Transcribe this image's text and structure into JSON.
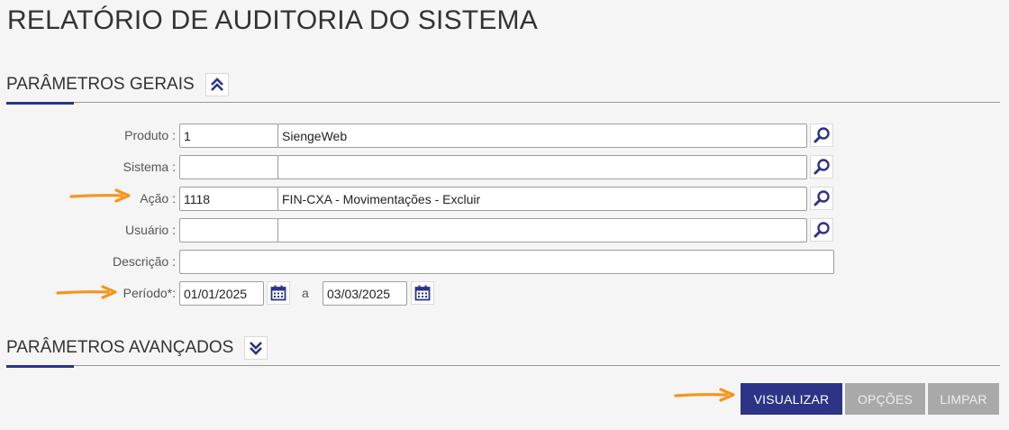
{
  "page": {
    "title": "RELATÓRIO DE AUDITORIA DO SISTEMA"
  },
  "general": {
    "title": "PARÂMETROS GERAIS",
    "toggle_icon": "chevron-double-up-icon",
    "fields": {
      "produto": {
        "label": "Produto :",
        "code": "1",
        "description": "SiengeWeb"
      },
      "sistema": {
        "label": "Sistema :",
        "code": "",
        "description": ""
      },
      "acao": {
        "label": "Ação :",
        "code": "1118",
        "description": "FIN-CXA - Movimentações - Excluir"
      },
      "usuario": {
        "label": "Usuário :",
        "code": "",
        "description": ""
      },
      "descricao": {
        "label": "Descrição :",
        "value": ""
      },
      "periodo": {
        "label": "Período*:",
        "start": "01/01/2025",
        "separator": "a",
        "end": "03/03/2025"
      }
    }
  },
  "advanced": {
    "title": "PARÂMETROS AVANÇADOS",
    "toggle_icon": "chevron-double-down-icon"
  },
  "actions": {
    "visualizar": "VISUALIZAR",
    "opcoes": "OPÇÕES",
    "limpar": "LIMPAR"
  },
  "colors": {
    "primary": "#2b3486",
    "disabled": "#a9a9a9",
    "annotation_arrow": "#f7941d",
    "background": "#f5f5f5"
  }
}
